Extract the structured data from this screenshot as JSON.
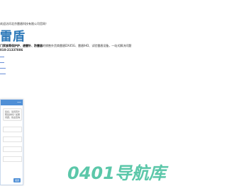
{
  "header": {
    "welcome": "欢迎访问北京雷盾科技有限公司官网！",
    "brand": "雷盾",
    "line1_bold": "门家族等保护护、避雷针、防雷器",
    "line1_rest": "的销售外货商雷盾DX45G、雷盾IHD、试验雷盾设备，一站式解决问题",
    "line2": "010-21337886"
  },
  "nav": {
    "items": [
      "",
      "",
      "",
      ""
    ]
  },
  "chat": {
    "close": "—",
    "bubble_lines": [
      "您好，请问有什么可以",
      "帮您的吗？如果有任何",
      "问题，欢迎咨询，我们会"
    ],
    "send": "发送"
  },
  "watermark": {
    "text": "0401导航库"
  },
  "colors": {
    "brand": "#2a77b8",
    "chat_header": "#4f8fd6",
    "watermark": "#5bc7a9"
  }
}
